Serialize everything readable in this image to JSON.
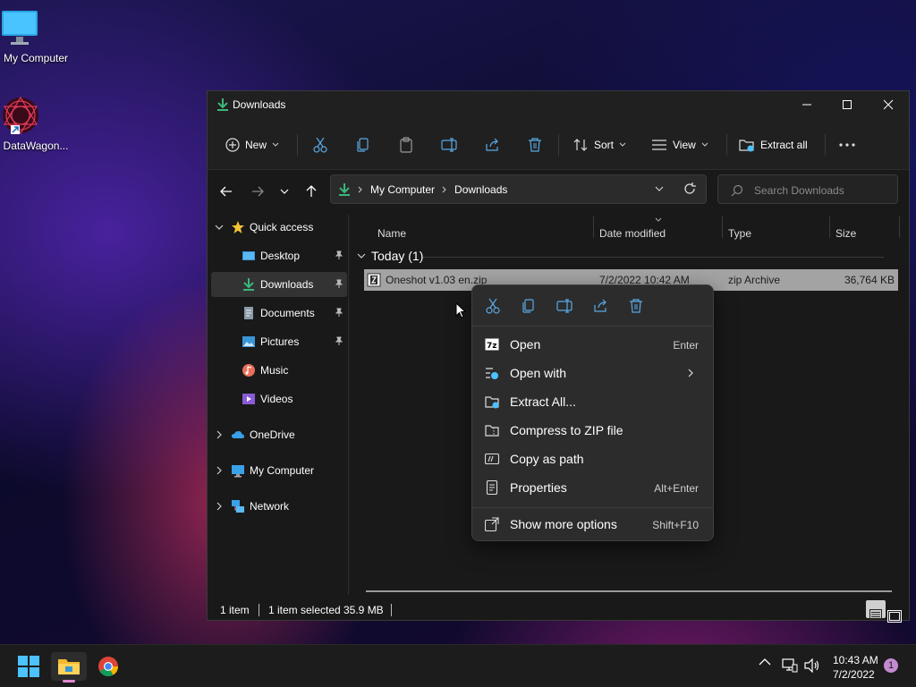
{
  "desktop": {
    "icons": [
      {
        "label": "My Computer"
      },
      {
        "label": "DataWagon..."
      }
    ]
  },
  "window": {
    "title": "Downloads",
    "toolbar": {
      "new_label": "New",
      "sort_label": "Sort",
      "view_label": "View",
      "extract_label": "Extract all"
    },
    "breadcrumb": [
      "My Computer",
      "Downloads"
    ],
    "search_placeholder": "Search Downloads",
    "sidebar": {
      "quick_access": "Quick access",
      "items": [
        {
          "label": "Desktop",
          "pinned": true
        },
        {
          "label": "Downloads",
          "pinned": true
        },
        {
          "label": "Documents",
          "pinned": true
        },
        {
          "label": "Pictures",
          "pinned": true
        },
        {
          "label": "Music",
          "pinned": false
        },
        {
          "label": "Videos",
          "pinned": false
        }
      ],
      "roots": [
        {
          "label": "OneDrive"
        },
        {
          "label": "My Computer"
        },
        {
          "label": "Network"
        }
      ]
    },
    "columns": [
      "Name",
      "Date modified",
      "Type",
      "Size"
    ],
    "group_label": "Today (1)",
    "files": [
      {
        "name": "Oneshot v1.03 en.zip",
        "date": "7/2/2022 10:42 AM",
        "type": "zip Archive",
        "size": "36,764 KB"
      }
    ],
    "status": {
      "count": "1 item",
      "selected": "1 item selected",
      "size": "35.9 MB"
    }
  },
  "context_menu": {
    "items": [
      {
        "label": "Open",
        "shortcut": "Enter"
      },
      {
        "label": "Open with",
        "shortcut": ""
      },
      {
        "label": "Extract All...",
        "shortcut": ""
      },
      {
        "label": "Compress to ZIP file",
        "shortcut": ""
      },
      {
        "label": "Copy as path",
        "shortcut": ""
      },
      {
        "label": "Properties",
        "shortcut": "Alt+Enter"
      },
      {
        "label": "Show more options",
        "shortcut": "Shift+F10"
      }
    ]
  },
  "taskbar": {
    "time": "10:43 AM",
    "date": "7/2/2022",
    "notification_count": "1"
  },
  "colors": {
    "accent": "#4cc2ff",
    "download_green": "#3bb67a",
    "selection_gray": "#a3a3a3"
  }
}
